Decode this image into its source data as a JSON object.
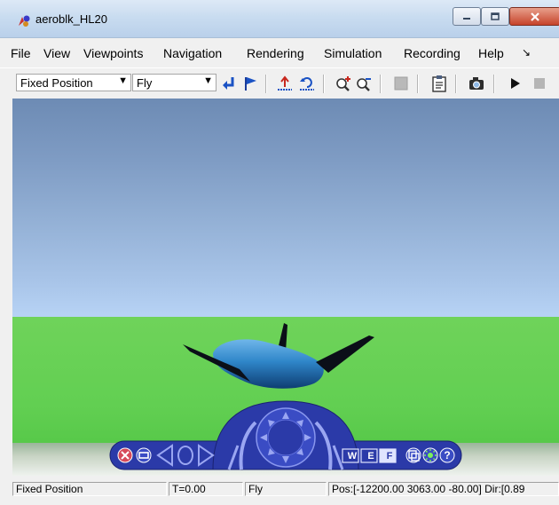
{
  "window": {
    "title": "aeroblk_HL20"
  },
  "menu": [
    "File",
    "View",
    "Viewpoints",
    "Navigation",
    "Rendering",
    "Simulation",
    "Recording",
    "Help"
  ],
  "toolbar": {
    "viewpoint_combo": "Fixed Position",
    "navigation_combo": "Fly"
  },
  "status": {
    "viewpoint": "Fixed Position",
    "time": "T=0.00",
    "navigation": "Fly",
    "position": "Pos:[-12200.00 3063.00 -80.00] Dir:[0.89"
  },
  "navpanel": {
    "wall_label": "W",
    "ex_label": "E",
    "fly_label": "F",
    "help_label": "?"
  },
  "colors": {
    "sky_top": "#6d8bb4",
    "ground": "#62cf52",
    "nav_panel": "#2b3aa8",
    "aircraft": "#2f86c9"
  }
}
